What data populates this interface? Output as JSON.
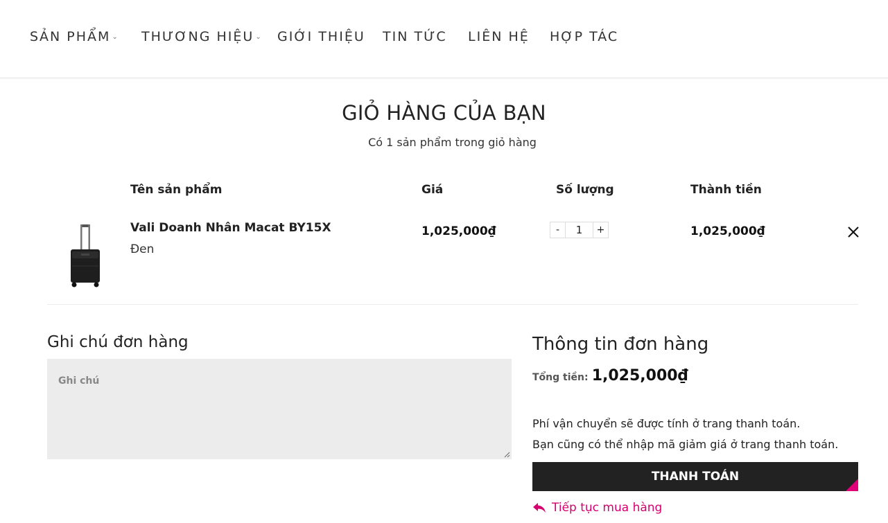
{
  "nav": {
    "items": [
      {
        "label": "SẢN PHẨM",
        "chevron": "⌄"
      },
      {
        "label": "THƯƠNG HIỆU",
        "chevron": "⌄"
      },
      {
        "label": "GIỚI THIỆU",
        "chevron": ""
      },
      {
        "label": "TIN TỨC",
        "chevron": ""
      },
      {
        "label": "LIÊN HỆ",
        "chevron": ""
      },
      {
        "label": "HỢP TÁC",
        "chevron": ""
      }
    ]
  },
  "cart": {
    "title": "GIỎ HÀNG CỦA BẠN",
    "subtitle": "Có 1 sản phẩm trong giỏ hàng",
    "headers": {
      "name": "Tên sản phẩm",
      "price": "Giá",
      "quantity": "Số lượng",
      "total": "Thành tiền"
    },
    "items": [
      {
        "name": "Vali Doanh Nhân Macat BY15X",
        "variant": "Đen",
        "price": "1,025,000₫",
        "quantity": "1",
        "total": "1,025,000₫",
        "decrement_label": "-",
        "increment_label": "+",
        "image_icon": "suitcase-icon",
        "remove_icon": "close-icon"
      }
    ]
  },
  "note": {
    "title": "Ghi chú đơn hàng",
    "placeholder": "Ghi chú"
  },
  "order_info": {
    "title": "Thông tin đơn hàng",
    "total_label": "Tổng tiền:",
    "total_value": "1,025,000₫",
    "shipping_line1": "Phí vận chuyển sẽ được tính ở trang thanh toán.",
    "shipping_line2": "Bạn cũng có thể nhập mã giảm giá ở trang thanh toán.",
    "checkout_label": "THANH TOÁN",
    "continue_label": "Tiếp tục mua hàng",
    "continue_icon": "reply-arrow-icon"
  },
  "colors": {
    "accent": "#e0007a",
    "link": "#d6006f",
    "button_bg": "#222222",
    "note_bg": "#ececec"
  }
}
